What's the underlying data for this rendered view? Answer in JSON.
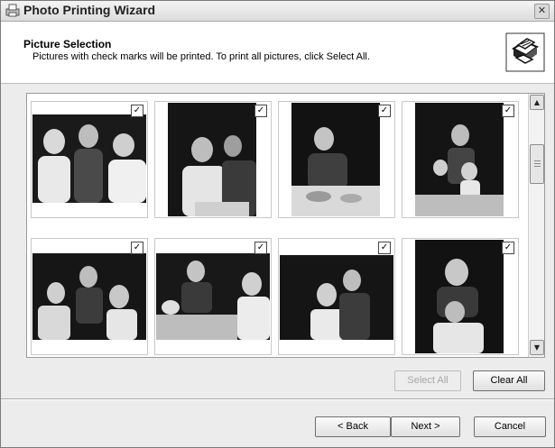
{
  "window": {
    "title": "Photo Printing Wizard"
  },
  "header": {
    "title": "Picture Selection",
    "subtitle": "Pictures with check marks will be printed.  To print all pictures, click Select All."
  },
  "thumbnails": [
    {
      "checked": true,
      "check_glyph": "✓"
    },
    {
      "checked": true,
      "check_glyph": "✓"
    },
    {
      "checked": true,
      "check_glyph": "✓"
    },
    {
      "checked": true,
      "check_glyph": "✓"
    },
    {
      "checked": true,
      "check_glyph": "✓"
    },
    {
      "checked": true,
      "check_glyph": "✓"
    },
    {
      "checked": true,
      "check_glyph": "✓"
    },
    {
      "checked": true,
      "check_glyph": "✓"
    }
  ],
  "buttons": {
    "select_all": "Select All",
    "clear_all": "Clear All",
    "back": "< Back",
    "next": "Next >",
    "cancel": "Cancel"
  },
  "icons": {
    "close": "✕",
    "scroll_up": "▲",
    "scroll_down": "▼"
  }
}
